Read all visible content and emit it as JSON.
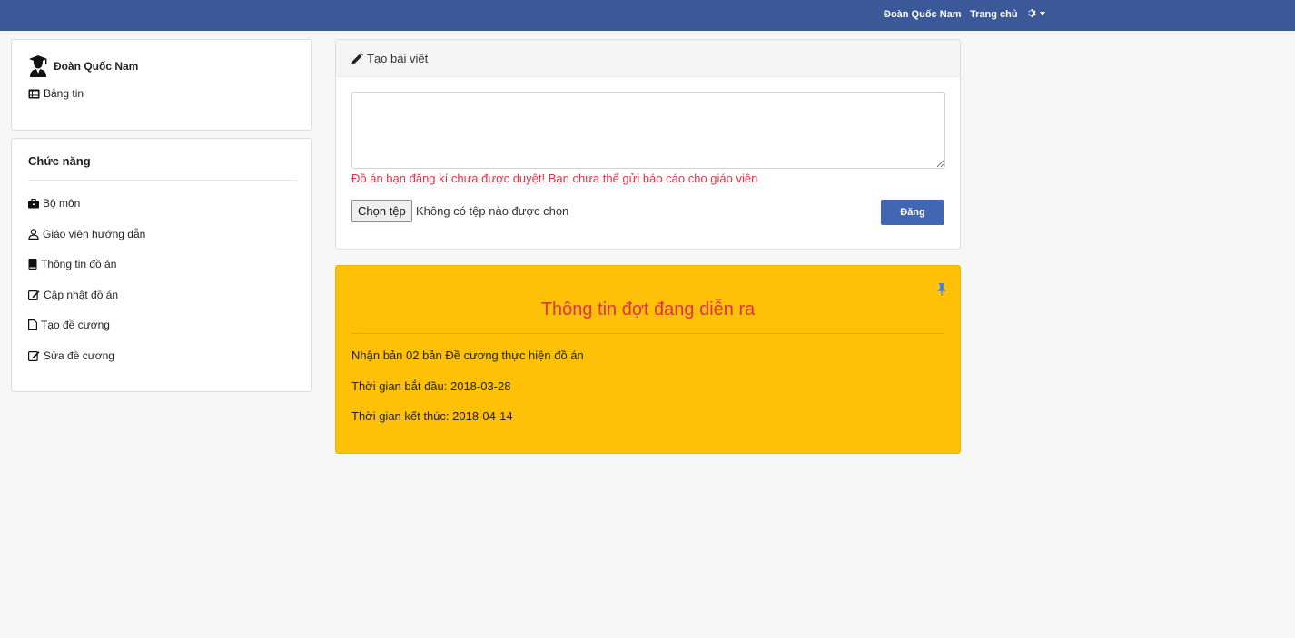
{
  "navbar": {
    "user_name": "Đoàn Quốc Nam",
    "home_label": "Trang chủ",
    "settings_icon": "gear-icon",
    "color": "#3b5998"
  },
  "profile": {
    "name": "Đoàn Quốc Nam",
    "avatar_icon": "graduate-user-icon",
    "feed_label": "Bảng tin",
    "feed_icon": "list-card-icon"
  },
  "functions": {
    "title": "Chức năng",
    "items": [
      {
        "label": "Bộ môn",
        "icon": "briefcase-icon"
      },
      {
        "label": "Giáo viên hướng dẫn",
        "icon": "user-icon"
      },
      {
        "label": "Thông tin đồ án",
        "icon": "book-icon"
      },
      {
        "label": "Cập nhật đồ án",
        "icon": "edit-icon"
      },
      {
        "label": "Tạo đề cương",
        "icon": "file-icon"
      },
      {
        "label": "Sửa đề cương",
        "icon": "edit-icon"
      }
    ]
  },
  "post": {
    "header": "Tạo bài viết",
    "header_icon": "pencil-icon",
    "textarea_value": "",
    "error": "Đồ án bạn đăng kí chưa được duyệt! Bạn chưa thể gửi báo cáo cho giáo viên",
    "file_button": "Chọn tệp",
    "file_status": "Không có tệp nào được chọn",
    "submit_label": "Đăng",
    "submit_color": "#4267b2"
  },
  "info": {
    "title": "Thông tin đợt đang diễn ra",
    "pin_icon": "thumbtack-icon",
    "lines": [
      "Nhận bản 02 bản Đề cương thực hiện đồ án",
      "Thời gian bắt đầu: 2018-03-28",
      "Thời gian kết thúc: 2018-04-14"
    ],
    "background": "#ffc107",
    "title_color": "#dc3545"
  }
}
